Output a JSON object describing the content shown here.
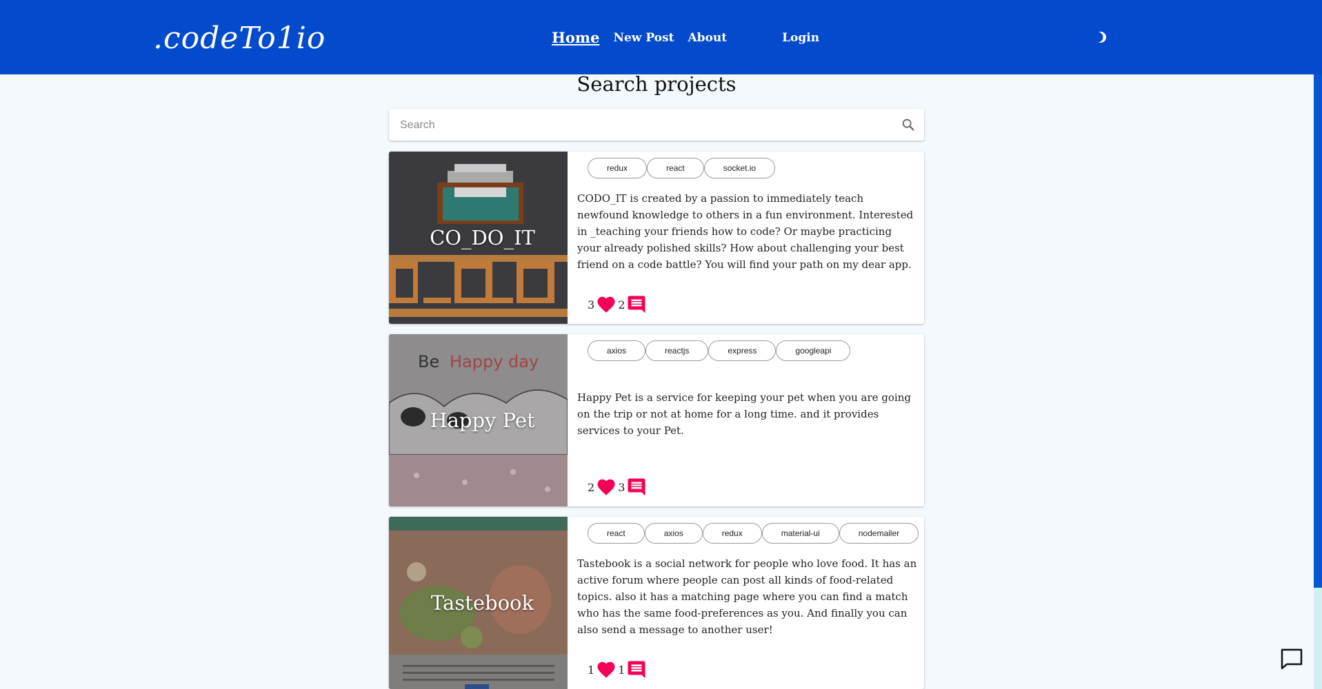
{
  "header": {
    "logo": ".codeTo1io",
    "nav": {
      "home": "Home",
      "new_post": "New Post",
      "about": "About",
      "login": "Login"
    },
    "theme_toggle_icon": "moon-icon"
  },
  "main": {
    "title": "Search projects",
    "search": {
      "placeholder": "Search",
      "value": ""
    }
  },
  "projects": [
    {
      "title": "CO_DO_IT",
      "tags": [
        "redux",
        "react",
        "socket.io"
      ],
      "description": "CODO_IT is created by a passion to immediately teach newfound knowledge to others in a fun environment. Interested in _teaching your friends how to code? Or maybe practicing your already polished skills? How about challenging your best friend on a code battle? You will find your path on my dear app.",
      "likes": "3",
      "comments": "2"
    },
    {
      "title": "Happy Pet",
      "tags": [
        "axios",
        "reactjs",
        "express",
        "googleapi"
      ],
      "description": "Happy Pet is a service for keeping your pet when you are going on the trip or not at home for a long time. and it provides services to your Pet.",
      "likes": "2",
      "comments": "3"
    },
    {
      "title": "Tastebook",
      "tags": [
        "react",
        "axios",
        "redux",
        "material-ui",
        "nodemailer"
      ],
      "description": "Tastebook is a social network for people who love food. It has an active forum where people can post all kinds of food-related topics. also it has a matching page where you can find a match who has the same food-preferences as you. And finally you can also send a message to another user!",
      "likes": "1",
      "comments": "1"
    }
  ],
  "colors": {
    "navbar": "#034bcc",
    "accent": "#f50057",
    "background": "#f3f9fd"
  }
}
